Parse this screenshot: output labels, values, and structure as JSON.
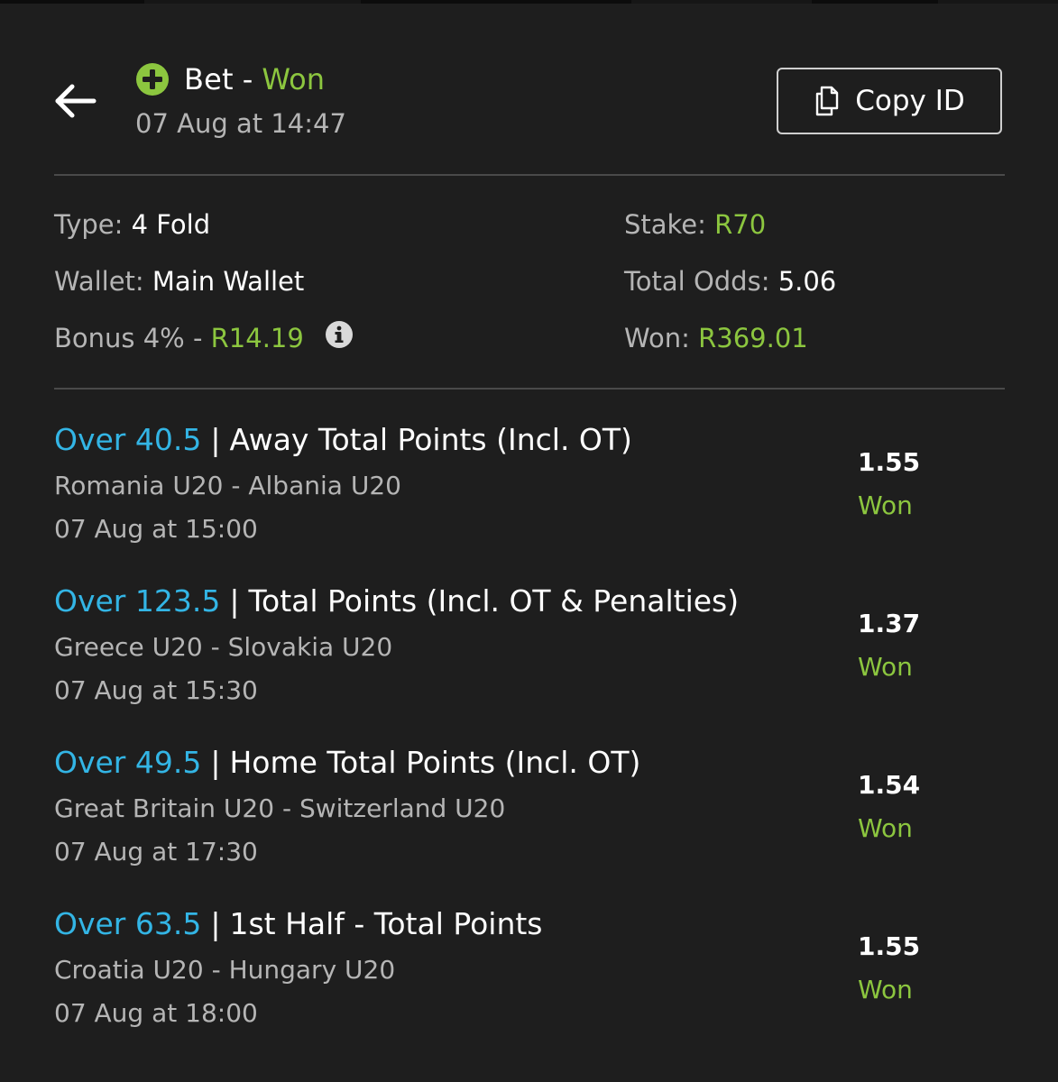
{
  "header": {
    "back_icon": "arrow-left-icon",
    "status_icon": "plus-circle-icon",
    "title": "Bet",
    "separator": "-",
    "status": "Won",
    "date": "07 Aug at 14:47",
    "copy_button": {
      "icon": "copy-icon",
      "label": "Copy ID"
    }
  },
  "summary": {
    "type_label": "Type:",
    "type_value": "4 Fold",
    "wallet_label": "Wallet:",
    "wallet_value": "Main Wallet",
    "bonus_label": "Bonus 4% -",
    "bonus_value": "R14.19",
    "bonus_info_icon": "info-icon",
    "stake_label": "Stake:",
    "stake_value": "R70",
    "odds_label": "Total Odds:",
    "odds_value": "5.06",
    "won_label": "Won:",
    "won_value": "R369.01"
  },
  "legs": [
    {
      "selection": "Over 40.5",
      "separator": "|",
      "market": "Away Total Points (Incl. OT)",
      "event": "Romania U20 - Albania U20",
      "date": "07 Aug at 15:00",
      "odds": "1.55",
      "result": "Won"
    },
    {
      "selection": "Over 123.5",
      "separator": "|",
      "market": "Total Points (Incl. OT & Penalties)",
      "event": "Greece U20 - Slovakia U20",
      "date": "07 Aug at 15:30",
      "odds": "1.37",
      "result": "Won"
    },
    {
      "selection": "Over 49.5",
      "separator": "|",
      "market": "Home Total Points (Incl. OT)",
      "event": "Great Britain U20 - Switzerland U20",
      "date": "07 Aug at 17:30",
      "odds": "1.54",
      "result": "Won"
    },
    {
      "selection": "Over 63.5",
      "separator": "|",
      "market": "1st Half - Total Points",
      "event": "Croatia U20 - Hungary U20",
      "date": "07 Aug at 18:00",
      "odds": "1.55",
      "result": "Won"
    }
  ],
  "colors": {
    "background": "#1e1e1e",
    "won_green": "#8cc63f",
    "selection_blue": "#33b5e5",
    "muted_text": "#b5b5b5"
  }
}
